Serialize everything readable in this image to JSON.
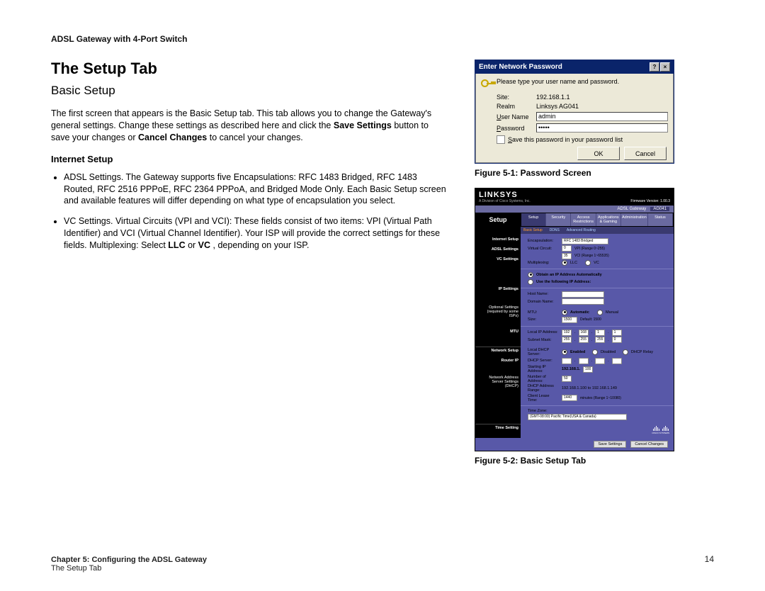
{
  "header": "ADSL Gateway with 4-Port Switch",
  "title": "The Setup Tab",
  "subheading": "Basic Setup",
  "para1_a": "The first screen that appears is the Basic Setup tab. This tab allows you to change the Gateway's general settings. Change these settings as described here and click the ",
  "para1_b": "Save Settings",
  "para1_c": " button to save your changes or ",
  "para1_d": "Cancel Changes",
  "para1_e": " to cancel your changes.",
  "section_internet": "Internet Setup",
  "bullet1": "ADSL Settings. The Gateway supports five Encapsulations: RFC 1483 Bridged, RFC 1483 Routed, RFC 2516 PPPoE, RFC 2364 PPPoA, and Bridged Mode Only. Each Basic Setup screen and available features will differ depending on what type of encapsulation you select.",
  "bullet2_a": "VC Settings. Virtual Circuits (VPI and VCI): These fields consist of two items: VPI (Virtual Path Identifier) and VCI (Virtual Channel Identifier). Your ISP will provide the correct settings for these fields. Multiplexing: Select ",
  "bullet2_b": "LLC",
  "bullet2_c": " or ",
  "bullet2_d": "VC",
  "bullet2_e": " , depending on your ISP.",
  "fig1_caption": "Figure 5-1: Password Screen",
  "fig2_caption": "Figure 5-2: Basic Setup Tab",
  "footer_line1": "Chapter 5: Configuring the ADSL Gateway",
  "footer_line2": "The Setup Tab",
  "page_number": "14",
  "dlg": {
    "title": "Enter Network Password",
    "help_btn": "?",
    "close_btn": "×",
    "msg": "Please type your user name and password.",
    "site_label": "Site:",
    "site_value": "192.168.1.1",
    "realm_label": "Realm",
    "realm_value": "Linksys AG041",
    "user_label_pre": "U",
    "user_label": "ser Name",
    "user_value": "admin",
    "pass_label_pre": "P",
    "pass_label": "assword",
    "pass_value": "•••••",
    "save_chk_pre": "S",
    "save_chk": "ave this password in your password list",
    "ok": "OK",
    "cancel": "Cancel"
  },
  "router": {
    "brand": "LINKSYS",
    "brand_sub": "A Division of Cisco Systems, Inc.",
    "firmware": "Firmware Version: 1.00.3",
    "product_line": "ADSL Gateway",
    "model": "AG041",
    "section": "Setup",
    "tabs": [
      "Setup",
      "Security",
      "Access Restrictions",
      "Applications & Gaming",
      "Administration",
      "Status"
    ],
    "subtabs": [
      "Basic Setup",
      "DDNS",
      "Advanced Routing"
    ],
    "side": {
      "internet": "Internet Setup",
      "adsl": "ADSL Settings",
      "vc": "VC Settings",
      "ip": "IP Settings",
      "optional": "Optional Settings (required by some ISPs)",
      "mtu": "MTU",
      "network": "Network Setup",
      "routerip": "Router IP",
      "dhcp": "Network Address Server Settings (DHCP)",
      "time": "Time Setting"
    },
    "fields": {
      "encap_label": "Encapsulation:",
      "encap_value": "RFC 1483 Bridged",
      "vc_label": "Virtual Circuit:",
      "vpi_value": "0",
      "vpi_note": "VPI (Range 0~255)",
      "vci_value": "35",
      "vci_note": "VCI (Range 1~65535)",
      "multi_label": "Multiplexing:",
      "multi_llc": "LLC",
      "multi_vc": "VC",
      "ip_auto": "Obtain an IP Address Automatically",
      "ip_static": "Use the following IP Address:",
      "host_label": "Host Name:",
      "domain_label": "Domain Name:",
      "mtu_label": "MTU:",
      "mtu_auto": "Automatic",
      "mtu_manual": "Manual",
      "size_label": "Size:",
      "size_value": "1500",
      "size_note": "Default: 1500",
      "localip_label": "Local IP Address:",
      "localip": [
        "192",
        "168",
        "1",
        "1"
      ],
      "subnet_label": "Subnet Mask:",
      "subnet": [
        "255",
        "255",
        "255",
        "0"
      ],
      "dhcp_label": "Local DHCP Server:",
      "dhcp_enabled": "Enabled",
      "dhcp_disabled": "Disabled",
      "dhcp_relay": "DHCP Relay",
      "dhcp_server_label": "DHCP Server:",
      "start_label": "Starting IP Address:",
      "start_prefix": "192.168.1.",
      "start_value": "100",
      "num_label": "Number of Address:",
      "num_value": "50",
      "range_label": "DHCP Address Range:",
      "range_value": "192.168.1.100 to 192.168.1.149",
      "lease_label": "Client Lease Time:",
      "lease_value": "1440",
      "lease_note": "minutes (Range 1~10080)",
      "tz_label": "Time Zone:",
      "tz_value": "(GMT-08:00) Pacific Time(USA & Canada)"
    },
    "buttons": {
      "save": "Save Settings",
      "cancel": "Cancel Changes"
    },
    "cisco": "CISCO SYSTEMS"
  }
}
